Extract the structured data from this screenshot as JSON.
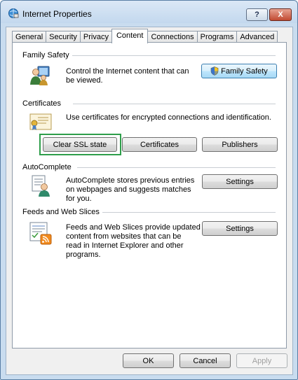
{
  "window": {
    "title": "Internet Properties",
    "help_label": "?",
    "close_label": "X"
  },
  "tabs": [
    {
      "label": "General"
    },
    {
      "label": "Security"
    },
    {
      "label": "Privacy"
    },
    {
      "label": "Content",
      "selected": true
    },
    {
      "label": "Connections"
    },
    {
      "label": "Programs"
    },
    {
      "label": "Advanced"
    }
  ],
  "family_safety": {
    "heading": "Family Safety",
    "description": [
      "Control the Internet content that can",
      "be viewed."
    ],
    "button_label": "Family Safety"
  },
  "certificates": {
    "heading": "Certificates",
    "description": "Use certificates for encrypted connections and identification.",
    "clear_ssl_label": "Clear SSL state",
    "certificates_label": "Certificates",
    "publishers_label": "Publishers"
  },
  "autocomplete": {
    "heading": "AutoComplete",
    "description": [
      "AutoComplete stores previous entries",
      "on webpages and suggests matches",
      "for you."
    ],
    "settings_label": "Settings"
  },
  "feeds": {
    "heading": "Feeds and Web Slices",
    "description": [
      "Feeds and Web Slices provide updated",
      "content from websites that can be",
      "read in Internet Explorer and other",
      "programs."
    ],
    "settings_label": "Settings"
  },
  "footer": {
    "ok_label": "OK",
    "cancel_label": "Cancel",
    "apply_label": "Apply"
  },
  "colors": {
    "highlight": "#2e9e4a",
    "close_button": "#c14a32"
  }
}
